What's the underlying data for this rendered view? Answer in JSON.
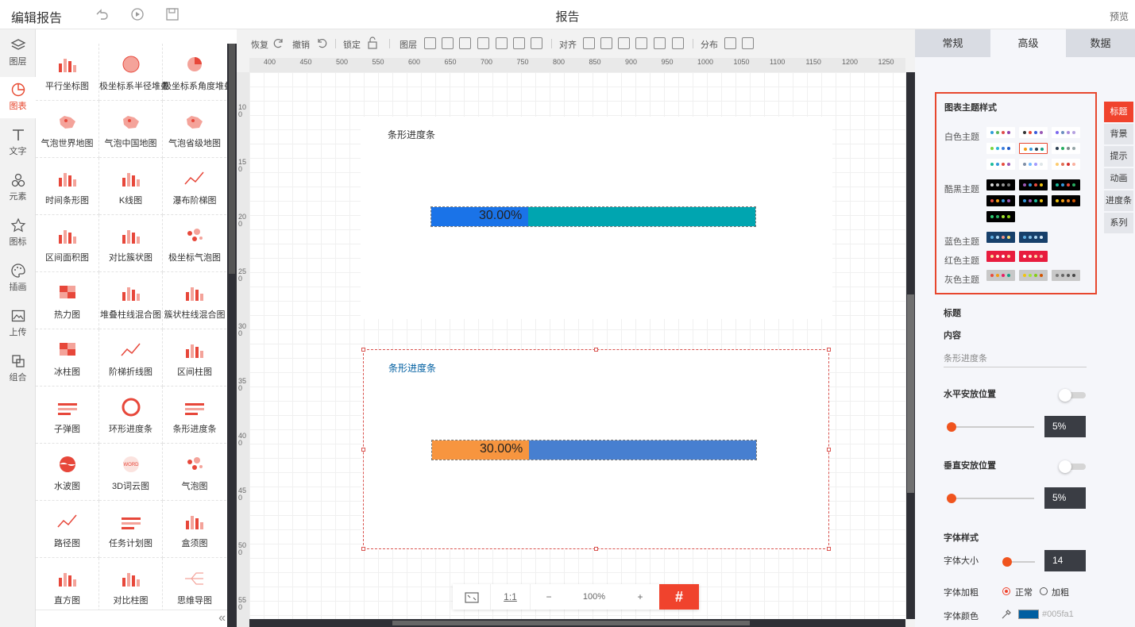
{
  "app": {
    "title": "编辑报告",
    "doc_title": "报告",
    "preview": "预览"
  },
  "left_nav": [
    {
      "label": "图层",
      "icon": "layers-icon"
    },
    {
      "label": "图表",
      "icon": "chart-icon"
    },
    {
      "label": "文字",
      "icon": "text-icon"
    },
    {
      "label": "元素",
      "icon": "shapes-icon"
    },
    {
      "label": "图标",
      "icon": "star-icon"
    },
    {
      "label": "插画",
      "icon": "palette-icon"
    },
    {
      "label": "上传",
      "icon": "image-upload-icon"
    },
    {
      "label": "组合",
      "icon": "group-icon"
    }
  ],
  "chart_types": [
    [
      "平行坐标图",
      "极坐标系半径堆叠",
      "极坐标系角度堆叠"
    ],
    [
      "气泡世界地图",
      "气泡中国地图",
      "气泡省级地图"
    ],
    [
      "时间条形图",
      "K线图",
      "瀑布阶梯图"
    ],
    [
      "区间面积图",
      "对比簇状图",
      "极坐标气泡图"
    ],
    [
      "热力图",
      "堆叠柱线混合图",
      "簇状柱线混合图"
    ],
    [
      "冰柱图",
      "阶梯折线图",
      "区间柱图"
    ],
    [
      "子弹图",
      "环形进度条",
      "条形进度条"
    ],
    [
      "水波图",
      "3D词云图",
      "气泡图"
    ],
    [
      "路径图",
      "任务计划图",
      "盒须图"
    ],
    [
      "直方图",
      "对比柱图",
      "思维导图"
    ]
  ],
  "toolbar": {
    "redo": "恢复",
    "undo": "撤销",
    "lock": "锁定",
    "layer": "图层",
    "align": "对齐",
    "distribute": "分布"
  },
  "ruler_h": [
    "400",
    "450",
    "500",
    "550",
    "600",
    "650",
    "700",
    "750",
    "800",
    "850",
    "900",
    "950",
    "1000",
    "1050",
    "1100",
    "1150",
    "1200",
    "1250"
  ],
  "ruler_v": [
    "100",
    "150",
    "200",
    "250",
    "300",
    "350",
    "400",
    "450",
    "500",
    "550"
  ],
  "charts": [
    {
      "title": "条形进度条",
      "label": "30.00%",
      "progress": 0.3,
      "fill_color": "#1a73e8",
      "rest_color": "#00a5b0",
      "title_color": "#333333"
    },
    {
      "title": "条形进度条",
      "label": "30.00%",
      "progress": 0.3,
      "fill_color": "#f7953f",
      "rest_color": "#477fd0",
      "title_color": "#005fa1"
    }
  ],
  "zoom": {
    "level": "100%",
    "ratio": "1:1",
    "minus": "−",
    "plus": "+",
    "grid": "#"
  },
  "right_panel": {
    "tabs": [
      "常规",
      "高级",
      "数据"
    ],
    "active_tab": 1,
    "theme_header": "图表主题样式",
    "theme_rows": [
      {
        "label": "白色主题",
        "count": 9
      },
      {
        "label": "酷黑主题",
        "count": 7
      },
      {
        "label": "蓝色主题",
        "count": 2
      },
      {
        "label": "红色主题",
        "count": 2
      },
      {
        "label": "灰色主题",
        "count": 3
      }
    ],
    "side_tags": [
      "标题",
      "背景",
      "提示",
      "动画",
      "进度条",
      "系列"
    ],
    "title_label": "标题",
    "content_label": "内容",
    "content_value": "条形进度条",
    "h_pos_label": "水平安放位置",
    "h_pos_value": "5%",
    "v_pos_label": "垂直安放位置",
    "v_pos_value": "5%",
    "font_style_label": "字体样式",
    "font_size_label": "字体大小",
    "font_size_value": "14",
    "font_weight_label": "字体加粗",
    "weight_normal": "正常",
    "weight_bold": "加粗",
    "font_color_label": "字体颜色",
    "font_color_value": "#005fa1"
  }
}
